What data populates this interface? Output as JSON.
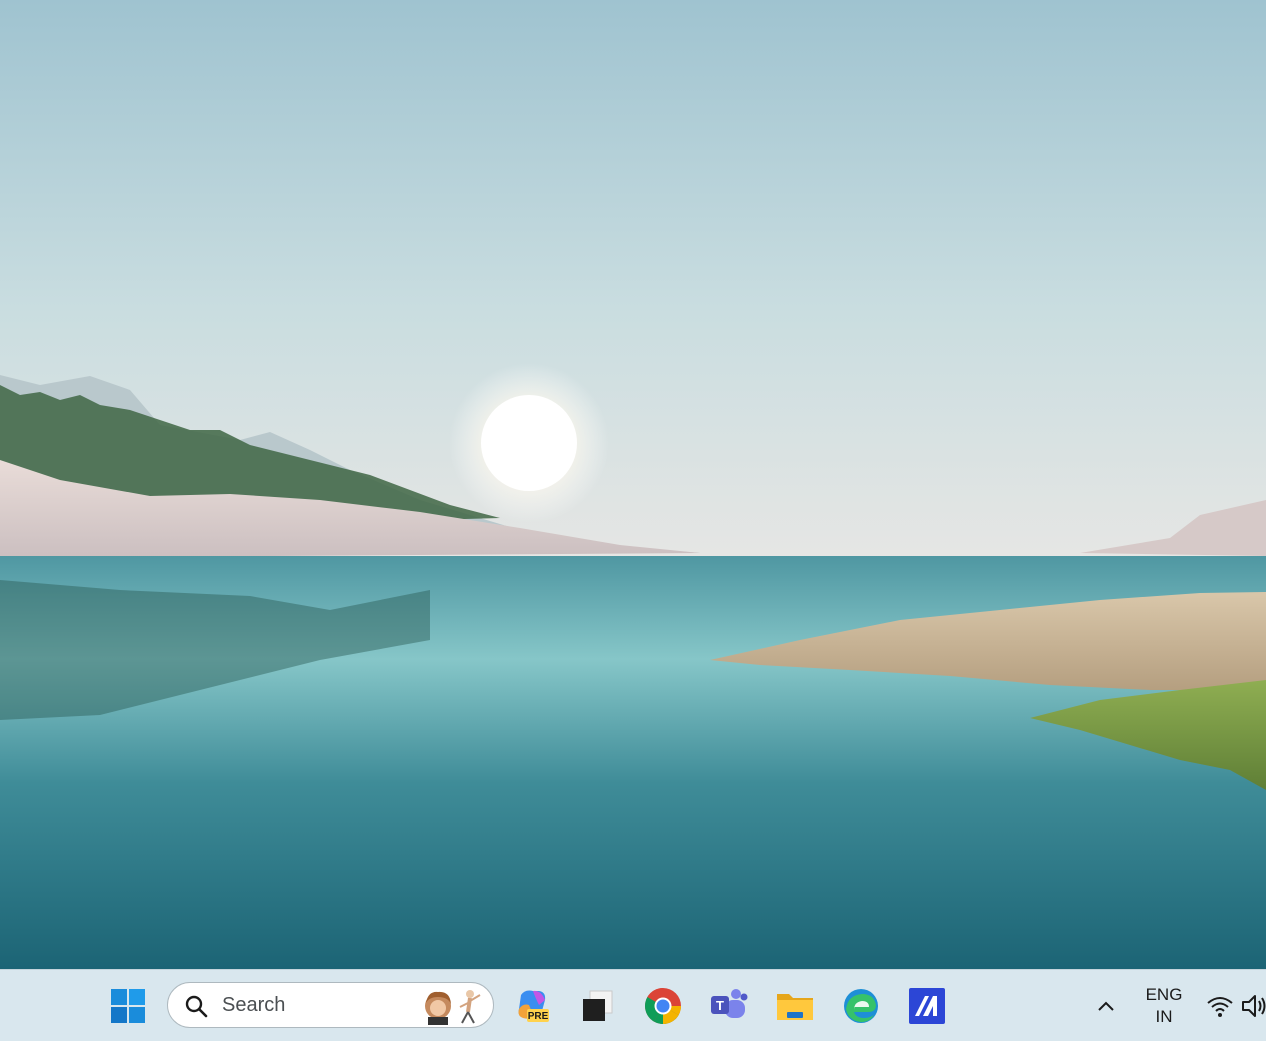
{
  "desktop": {
    "wallpaper": "landscape-lake-sunrise",
    "colors": {
      "sky_top": "#9fc3d0",
      "sky_bottom": "#e3e6e4",
      "water_top": "#5fa7b0",
      "water_bottom": "#1c6475"
    }
  },
  "taskbar": {
    "background": "#d9e7ee",
    "start_icon": "windows-logo-icon",
    "search": {
      "placeholder": "Search",
      "icon": "search-icon"
    },
    "pinned_apps": [
      {
        "name": "copilot-preview",
        "badge": "PRE"
      },
      {
        "name": "task-view"
      },
      {
        "name": "chrome"
      },
      {
        "name": "teams",
        "letter": "T"
      },
      {
        "name": "file-explorer"
      },
      {
        "name": "edge"
      },
      {
        "name": "app-blue"
      }
    ],
    "tray": {
      "language_line1": "ENG",
      "language_line2": "IN"
    }
  }
}
